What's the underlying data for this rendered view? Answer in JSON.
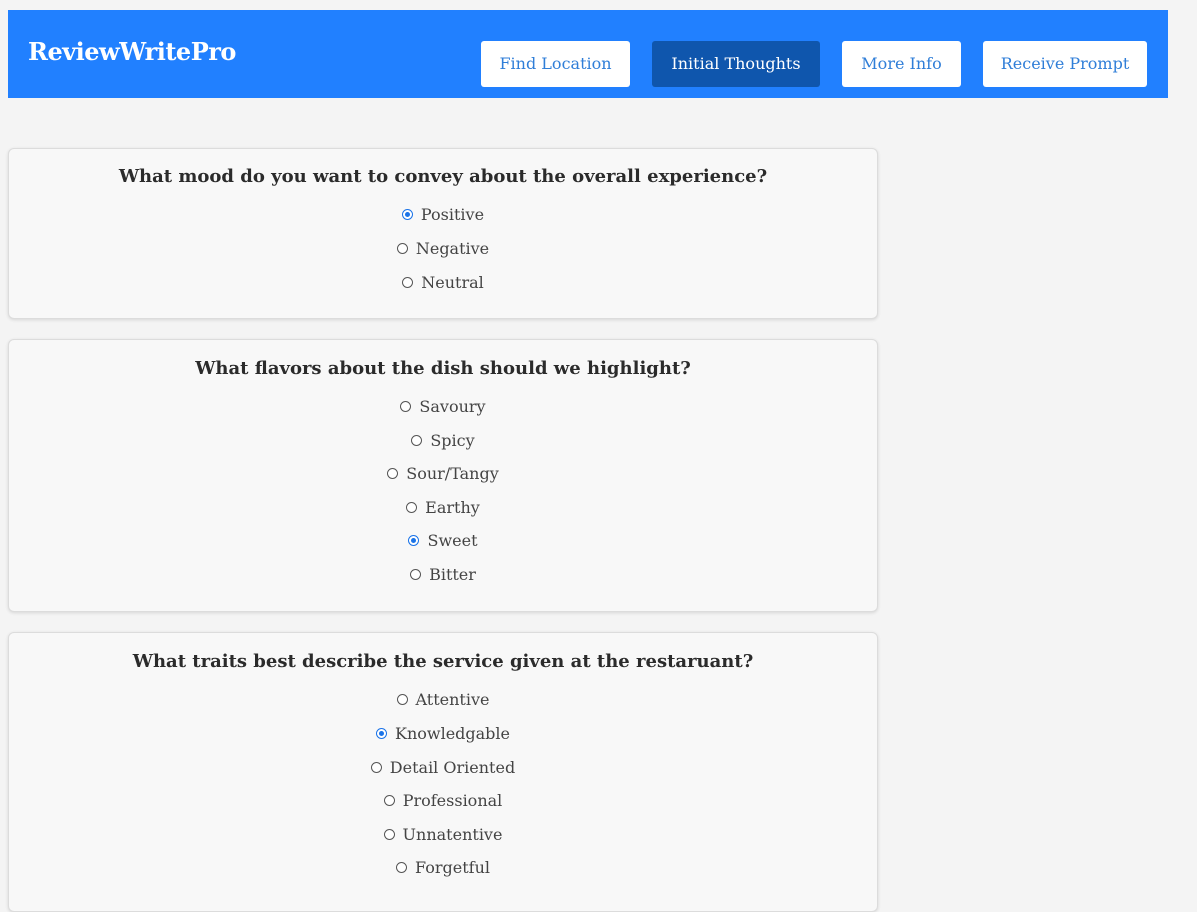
{
  "header": {
    "brand": "ReviewWritePro",
    "nav": [
      {
        "label": "Find Location",
        "active": false
      },
      {
        "label": "Initial Thoughts",
        "active": true
      },
      {
        "label": "More Info",
        "active": false
      },
      {
        "label": "Receive Prompt",
        "active": false
      }
    ],
    "accent_color": "#2180ff",
    "active_color": "#0f56ad"
  },
  "questions": [
    {
      "question": "What mood do you want to convey about the overall experience?",
      "options": [
        {
          "label": "Positive",
          "checked": true
        },
        {
          "label": "Negative",
          "checked": false
        },
        {
          "label": "Neutral",
          "checked": false
        }
      ]
    },
    {
      "question": "What flavors about the dish should we highlight?",
      "options": [
        {
          "label": "Savoury",
          "checked": false
        },
        {
          "label": "Spicy",
          "checked": false
        },
        {
          "label": "Sour/Tangy",
          "checked": false
        },
        {
          "label": "Earthy",
          "checked": false
        },
        {
          "label": "Sweet",
          "checked": true
        },
        {
          "label": "Bitter",
          "checked": false
        }
      ]
    },
    {
      "question": "What traits best describe the service given at the restaruant?",
      "options": [
        {
          "label": "Attentive",
          "checked": false
        },
        {
          "label": "Knowledgable",
          "checked": true
        },
        {
          "label": "Detail Oriented",
          "checked": false
        },
        {
          "label": "Professional",
          "checked": false
        },
        {
          "label": "Unnatentive",
          "checked": false
        },
        {
          "label": "Forgetful",
          "checked": false
        }
      ]
    }
  ]
}
